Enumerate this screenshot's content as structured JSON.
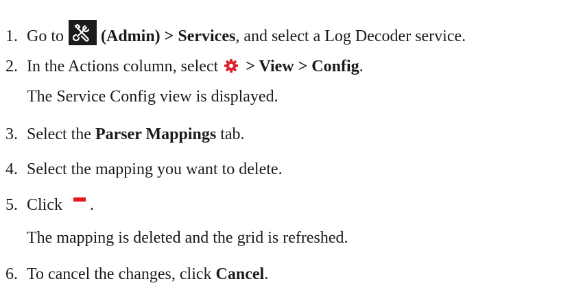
{
  "steps": [
    {
      "number": "1.",
      "pre": "Go to",
      "icon": "admin-tools-icon",
      "bold1": "(Admin) > Services",
      "post": ", and select a Log Decoder service."
    },
    {
      "number": "2.",
      "pre": "In the Actions column, select",
      "icon": "gear-icon",
      "bold1": "> View > Config",
      "post": ".",
      "result": "The Service Config view is displayed."
    },
    {
      "number": "3.",
      "pre": "Select the ",
      "bold1": "Parser Mappings",
      "post": " tab."
    },
    {
      "number": "4.",
      "pre": "Select the mapping you want to delete."
    },
    {
      "number": "5.",
      "pre": "Click",
      "icon": "minus-icon",
      "post": ".",
      "result": "The mapping is deleted and the grid is refreshed."
    },
    {
      "number": "6.",
      "pre": "To cancel the changes, click ",
      "bold1": "Cancel",
      "post": "."
    }
  ],
  "colors": {
    "text": "#1a1a1a",
    "admin_icon_bg": "#1b1b1b",
    "gear_icon": "#d9262c",
    "minus_icon": "#e0191e"
  }
}
